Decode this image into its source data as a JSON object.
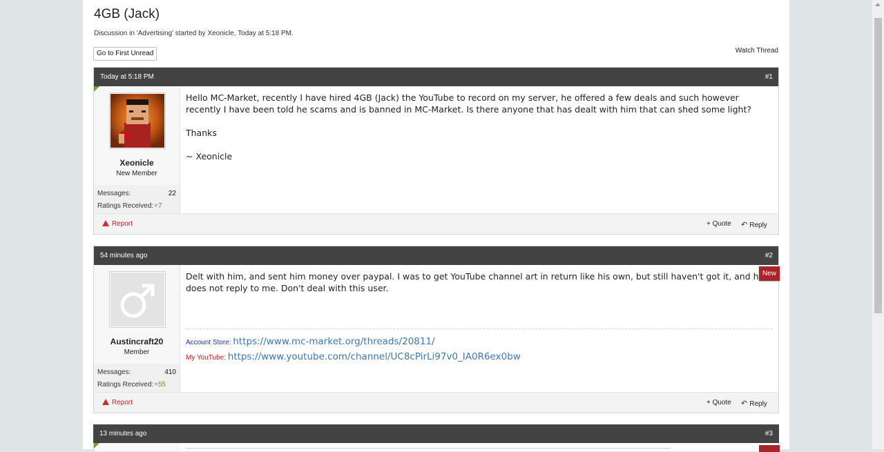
{
  "thread": {
    "title": "4GB (Jack)",
    "meta": "Discussion in 'Advertising' started by Xeonicle, Today at 5:18 PM.",
    "first_unread_label": "Go to First Unread",
    "watch_label": "Watch Thread"
  },
  "posts": [
    {
      "date": "Today at 5:18 PM",
      "number": "#1",
      "username": "Xeonicle",
      "user_title": "New Member",
      "messages_label": "Messages:",
      "messages_value": "22",
      "ratings_label": "Ratings Received:",
      "ratings_value": "+7",
      "body": [
        "Hello MC-Market, recently I have hired 4GB (Jack) the YouTube to record on my server, he offered a few deals and such however recently I have been told he scams and is banned in MC-Market. Is there anyone that has dealt with him that can shed some light?",
        "Thanks",
        "~ Xeonicle"
      ],
      "report_label": "Report",
      "quote_label": "+ Quote",
      "reply_label": "Reply"
    },
    {
      "date": "54 minutes ago",
      "number": "#2",
      "username": "Austincraft20",
      "user_title": "Member",
      "messages_label": "Messages:",
      "messages_value": "410",
      "ratings_label": "Ratings Received:",
      "ratings_value": "+55",
      "body": [
        "Delt with him, and sent him money over paypal. I was to get YouTube channel art in return like his own, but still haven't got it, and he does not reply to me. Don't deal with this user."
      ],
      "new_badge": "New",
      "signature": {
        "store_label": "Account Store:",
        "store_link": "https://www.mc-market.org/threads/20811/",
        "youtube_label": "My YouTube:",
        "youtube_link": "https://www.youtube.com/channel/UC8cPirLi97v0_IA0R6ex0bw"
      },
      "report_label": "Report",
      "quote_label": "+ Quote",
      "reply_label": "Reply"
    },
    {
      "date": "13 minutes ago",
      "number": "#3"
    }
  ],
  "colors": {
    "header_bg": "#434343",
    "new_badge": "#a8242a",
    "rating_green": "#55a01c",
    "link_blue": "#3a78b9",
    "report_red": "#c42222"
  }
}
